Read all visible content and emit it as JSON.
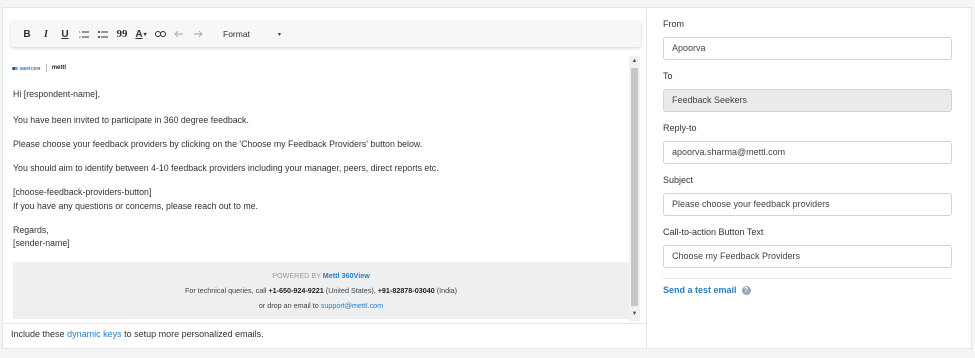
{
  "toolbar": {
    "bold": "B",
    "italic": "I",
    "underline": "U",
    "quote": "99",
    "font_color": "A",
    "format_label": "Format",
    "format_caret": "▾",
    "icons": [
      "bold-icon",
      "italic-icon",
      "underline-icon",
      "numbered-list-icon",
      "bullet-list-icon",
      "quote-icon",
      "font-color-icon",
      "link-icon",
      "undo-icon",
      "redo-icon"
    ]
  },
  "logos": {
    "mercer": "MERCER",
    "mettl": "mettl"
  },
  "email": {
    "greeting": "Hi [respondent-name],",
    "line1": "You have been invited to participate in 360 degree feedback.",
    "line2": "Please choose your feedback providers by clicking on the 'Choose my Feedback Providers' button below.",
    "line3": "You should aim to identify between 4-10 feedback providers including your manager, peers, direct reports etc.",
    "button_key": "[choose-feedback-providers-button]",
    "line4": "If you have any questions or concerns, please reach out to me.",
    "regards": "Regards,",
    "sender": "[sender-name]"
  },
  "footer": {
    "powered_by": "POWERED BY",
    "brand": "Mettl 360View",
    "queries_prefix": "For technical queries, call",
    "phone_us": "+1-650-924-9221",
    "us_label": "(United States),",
    "phone_in": "+91-82878-03040",
    "in_label": "(India)",
    "drop_prefix": "or drop an email to",
    "support_email": "support@mettl.com"
  },
  "hint": {
    "prefix": "Include these",
    "link": "dynamic keys",
    "suffix": "to setup more personalized emails."
  },
  "form": {
    "from_label": "From",
    "from_value": "Apoorva",
    "to_label": "To",
    "to_value": "Feedback Seekers",
    "reply_label": "Reply-to",
    "reply_value": "apoorva.sharma@mettl.com",
    "subject_label": "Subject",
    "subject_value": "Please choose your feedback providers",
    "cta_label": "Call-to-action Button Text",
    "cta_value": "Choose my Feedback Providers",
    "test_link": "Send a test email",
    "help_glyph": "?"
  },
  "colors": {
    "link": "#2a7fc4",
    "readonly_bg": "#e9eaec"
  }
}
